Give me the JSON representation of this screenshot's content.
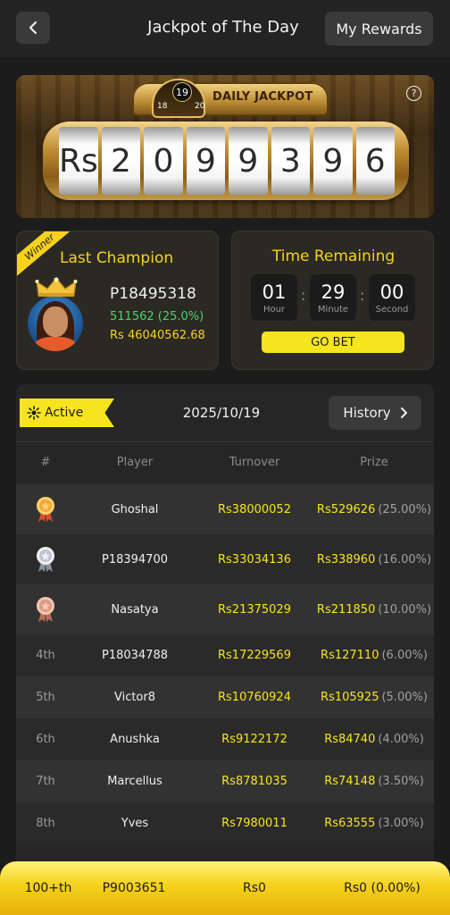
{
  "header": {
    "title": "Jackpot of The Day",
    "rewards_label": "My Rewards"
  },
  "jackpot": {
    "label": "DAILY JACKPOT",
    "dial": {
      "left": "18",
      "center": "19",
      "right": "20"
    },
    "digits": [
      "Rs",
      "2",
      "0",
      "9",
      "9",
      "3",
      "9",
      "6"
    ],
    "help_glyph": "?"
  },
  "champion": {
    "ribbon": "Winner",
    "title": "Last Champion",
    "player_id": "P18495318",
    "stat": "511562 (25.0%)",
    "amount": "Rs 46040562.68"
  },
  "timer": {
    "title": "Time Remaining",
    "hour": "01",
    "hour_label": "Hour",
    "minute": "29",
    "minute_label": "Minute",
    "second": "00",
    "second_label": "Second",
    "sep": ":",
    "go_label": "GO BET"
  },
  "board": {
    "status": "Active",
    "date": "2025/10/19",
    "history_label": "History",
    "columns": {
      "rank": "#",
      "player": "Player",
      "turnover": "Turnover",
      "prize": "Prize"
    },
    "rows": [
      {
        "rank": "",
        "medal": "gold",
        "player": "Ghoshal",
        "turnover": "Rs38000052",
        "prize": "Rs529626",
        "pct": "(25.00%)"
      },
      {
        "rank": "",
        "medal": "silver",
        "player": "P18394700",
        "turnover": "Rs33034136",
        "prize": "Rs338960",
        "pct": "(16.00%)"
      },
      {
        "rank": "",
        "medal": "bronze",
        "player": "Nasatya",
        "turnover": "Rs21375029",
        "prize": "Rs211850",
        "pct": "(10.00%)"
      },
      {
        "rank": "4th",
        "player": "P18034788",
        "turnover": "Rs17229569",
        "prize": "Rs127110",
        "pct": "(6.00%)"
      },
      {
        "rank": "5th",
        "player": "Victor8",
        "turnover": "Rs10760924",
        "prize": "Rs105925",
        "pct": "(5.00%)"
      },
      {
        "rank": "6th",
        "player": "Anushka",
        "turnover": "Rs9122172",
        "prize": "Rs84740",
        "pct": "(4.00%)"
      },
      {
        "rank": "7th",
        "player": "Marcellus",
        "turnover": "Rs8781035",
        "prize": "Rs74148",
        "pct": "(3.50%)"
      },
      {
        "rank": "8th",
        "player": "Yves",
        "turnover": "Rs7980011",
        "prize": "Rs63555",
        "pct": "(3.00%)"
      }
    ]
  },
  "my_rank": {
    "rank": "100+th",
    "player": "P9003651",
    "turnover": "Rs0",
    "prize": "Rs0 (0.00%)"
  },
  "colors": {
    "accent": "#f6e51e",
    "champion_pct": "#4ad36a",
    "background": "#1c1c1c"
  },
  "icons": [
    "back-arrow-icon",
    "help-icon",
    "crown-icon",
    "active-sun-icon",
    "chevron-right-icon",
    "gold-medal-icon",
    "silver-medal-icon",
    "bronze-medal-icon"
  ]
}
